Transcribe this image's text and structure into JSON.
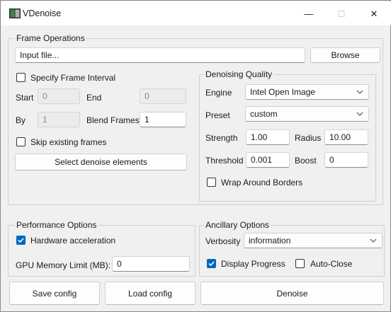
{
  "window": {
    "title": "VDenoise",
    "minimize_glyph": "—",
    "maximize_glyph": "☐",
    "close_glyph": "✕"
  },
  "frame_ops": {
    "legend": "Frame Operations",
    "input_file_placeholder": "Input file...",
    "browse_label": "Browse",
    "specify_interval_label": "Specify Frame Interval",
    "specify_interval_checked": false,
    "start_label": "Start",
    "start_value": "0",
    "end_label": "End",
    "end_value": "0",
    "by_label": "By",
    "by_value": "1",
    "blend_label": "Blend Frames",
    "blend_value": "1",
    "skip_existing_label": "Skip existing frames",
    "skip_existing_checked": false,
    "select_elements_label": "Select denoise elements"
  },
  "quality": {
    "legend": "Denoising Quality",
    "engine_label": "Engine",
    "engine_value": "Intel Open Image",
    "preset_label": "Preset",
    "preset_value": "custom",
    "strength_label": "Strength",
    "strength_value": "1.00",
    "radius_label": "Radius",
    "radius_value": "10.00",
    "threshold_label": "Threshold",
    "threshold_value": "0.001",
    "boost_label": "Boost",
    "boost_value": "0",
    "wrap_label": "Wrap Around Borders",
    "wrap_checked": false
  },
  "performance": {
    "legend": "Performance Options",
    "hw_accel_label": "Hardware acceleration",
    "hw_accel_checked": true,
    "gpu_limit_label": "GPU Memory Limit (MB):",
    "gpu_limit_value": "0"
  },
  "ancillary": {
    "legend": "Ancillary Options",
    "verbosity_label": "Verbosity",
    "verbosity_value": "information",
    "display_progress_label": "Display Progress",
    "display_progress_checked": true,
    "auto_close_label": "Auto-Close",
    "auto_close_checked": false
  },
  "footer": {
    "save_label": "Save config",
    "load_label": "Load config",
    "denoise_label": "Denoise"
  },
  "colors": {
    "accent": "#0067c0",
    "window_bg": "#f0f0f0",
    "titlebar_bg": "#ffffff"
  }
}
